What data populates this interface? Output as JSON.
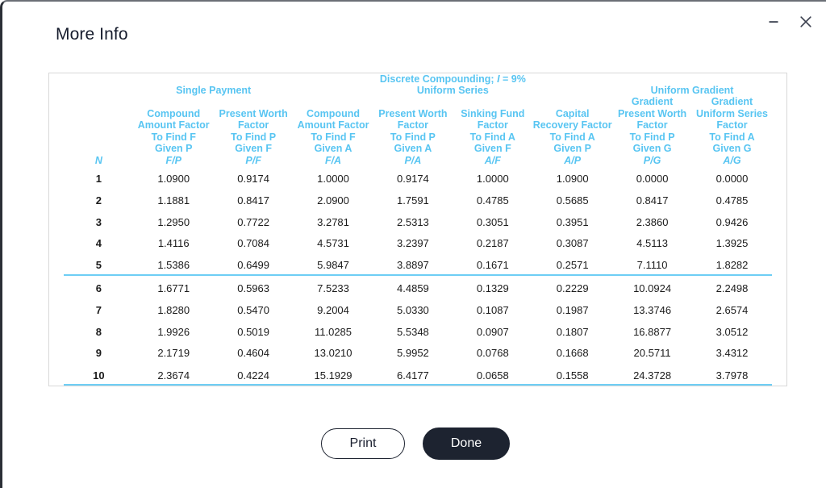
{
  "window": {
    "title": "More Info",
    "controls": [
      {
        "name": "minimize-button",
        "glyph": "minimize-icon",
        "label": "–"
      },
      {
        "name": "close-button",
        "glyph": "close-icon",
        "label": "✕"
      }
    ]
  },
  "table": {
    "caption": "Discrete Compounding; I = 9%",
    "caption_prefix": "Discrete Compounding; ",
    "caption_var": "I",
    "caption_suffix": " = 9%",
    "interest_rate": "9%",
    "groups": [
      {
        "label": "Single Payment",
        "span": 2
      },
      {
        "label": "Uniform Series",
        "span": 4
      },
      {
        "label": "Uniform Gradient",
        "span": 2
      }
    ],
    "index_header": "N",
    "columns": [
      {
        "name": "Compound Amount Factor",
        "to_find": "To Find F",
        "given": "Given P",
        "symbol": "F/P"
      },
      {
        "name": "Present Worth Factor",
        "to_find": "To Find P",
        "given": "Given F",
        "symbol": "P/F"
      },
      {
        "name": "Compound Amount Factor",
        "to_find": "To Find F",
        "given": "Given A",
        "symbol": "F/A"
      },
      {
        "name": "Present Worth Factor",
        "to_find": "To Find P",
        "given": "Given A",
        "symbol": "P/A"
      },
      {
        "name": "Sinking Fund Factor",
        "to_find": "To Find A",
        "given": "Given F",
        "symbol": "A/F"
      },
      {
        "name": "Capital Recovery Factor",
        "to_find": "To Find A",
        "given": "Given P",
        "symbol": "A/P"
      },
      {
        "name": "Gradient Present Worth Factor",
        "to_find": "To Find P",
        "given": "Given G",
        "symbol": "P/G"
      },
      {
        "name": "Gradient Uniform Series Factor",
        "to_find": "To Find A",
        "given": "Given G",
        "symbol": "A/G"
      }
    ],
    "rows": [
      {
        "n": "1",
        "values": [
          "1.0900",
          "0.9174",
          "1.0000",
          "0.9174",
          "1.0000",
          "1.0900",
          "0.0000",
          "0.0000"
        ]
      },
      {
        "n": "2",
        "values": [
          "1.1881",
          "0.8417",
          "2.0900",
          "1.7591",
          "0.4785",
          "0.5685",
          "0.8417",
          "0.4785"
        ]
      },
      {
        "n": "3",
        "values": [
          "1.2950",
          "0.7722",
          "3.2781",
          "2.5313",
          "0.3051",
          "0.3951",
          "2.3860",
          "0.9426"
        ]
      },
      {
        "n": "4",
        "values": [
          "1.4116",
          "0.7084",
          "4.5731",
          "3.2397",
          "0.2187",
          "0.3087",
          "4.5113",
          "1.3925"
        ]
      },
      {
        "n": "5",
        "values": [
          "1.5386",
          "0.6499",
          "5.9847",
          "3.8897",
          "0.1671",
          "0.2571",
          "7.1110",
          "1.8282"
        ]
      },
      {
        "n": "6",
        "values": [
          "1.6771",
          "0.5963",
          "7.5233",
          "4.4859",
          "0.1329",
          "0.2229",
          "10.0924",
          "2.2498"
        ]
      },
      {
        "n": "7",
        "values": [
          "1.8280",
          "0.5470",
          "9.2004",
          "5.0330",
          "0.1087",
          "0.1987",
          "13.3746",
          "2.6574"
        ]
      },
      {
        "n": "8",
        "values": [
          "1.9926",
          "0.5019",
          "11.0285",
          "5.5348",
          "0.0907",
          "0.1807",
          "16.8877",
          "3.0512"
        ]
      },
      {
        "n": "9",
        "values": [
          "2.1719",
          "0.4604",
          "13.0210",
          "5.9952",
          "0.0768",
          "0.1668",
          "20.5711",
          "3.4312"
        ]
      },
      {
        "n": "10",
        "values": [
          "2.3674",
          "0.4224",
          "15.1929",
          "6.4177",
          "0.0658",
          "0.1558",
          "24.3728",
          "3.7978"
        ]
      }
    ],
    "rule_after_row_index": 5
  },
  "footer": {
    "print_label": "Print",
    "done_label": "Done"
  },
  "colors": {
    "accent_blue": "#58c5f2",
    "rule_blue": "#6ecef5",
    "dark": "#1d2330",
    "title_text": "#161c2d",
    "card_border": "#d8d8d8"
  }
}
